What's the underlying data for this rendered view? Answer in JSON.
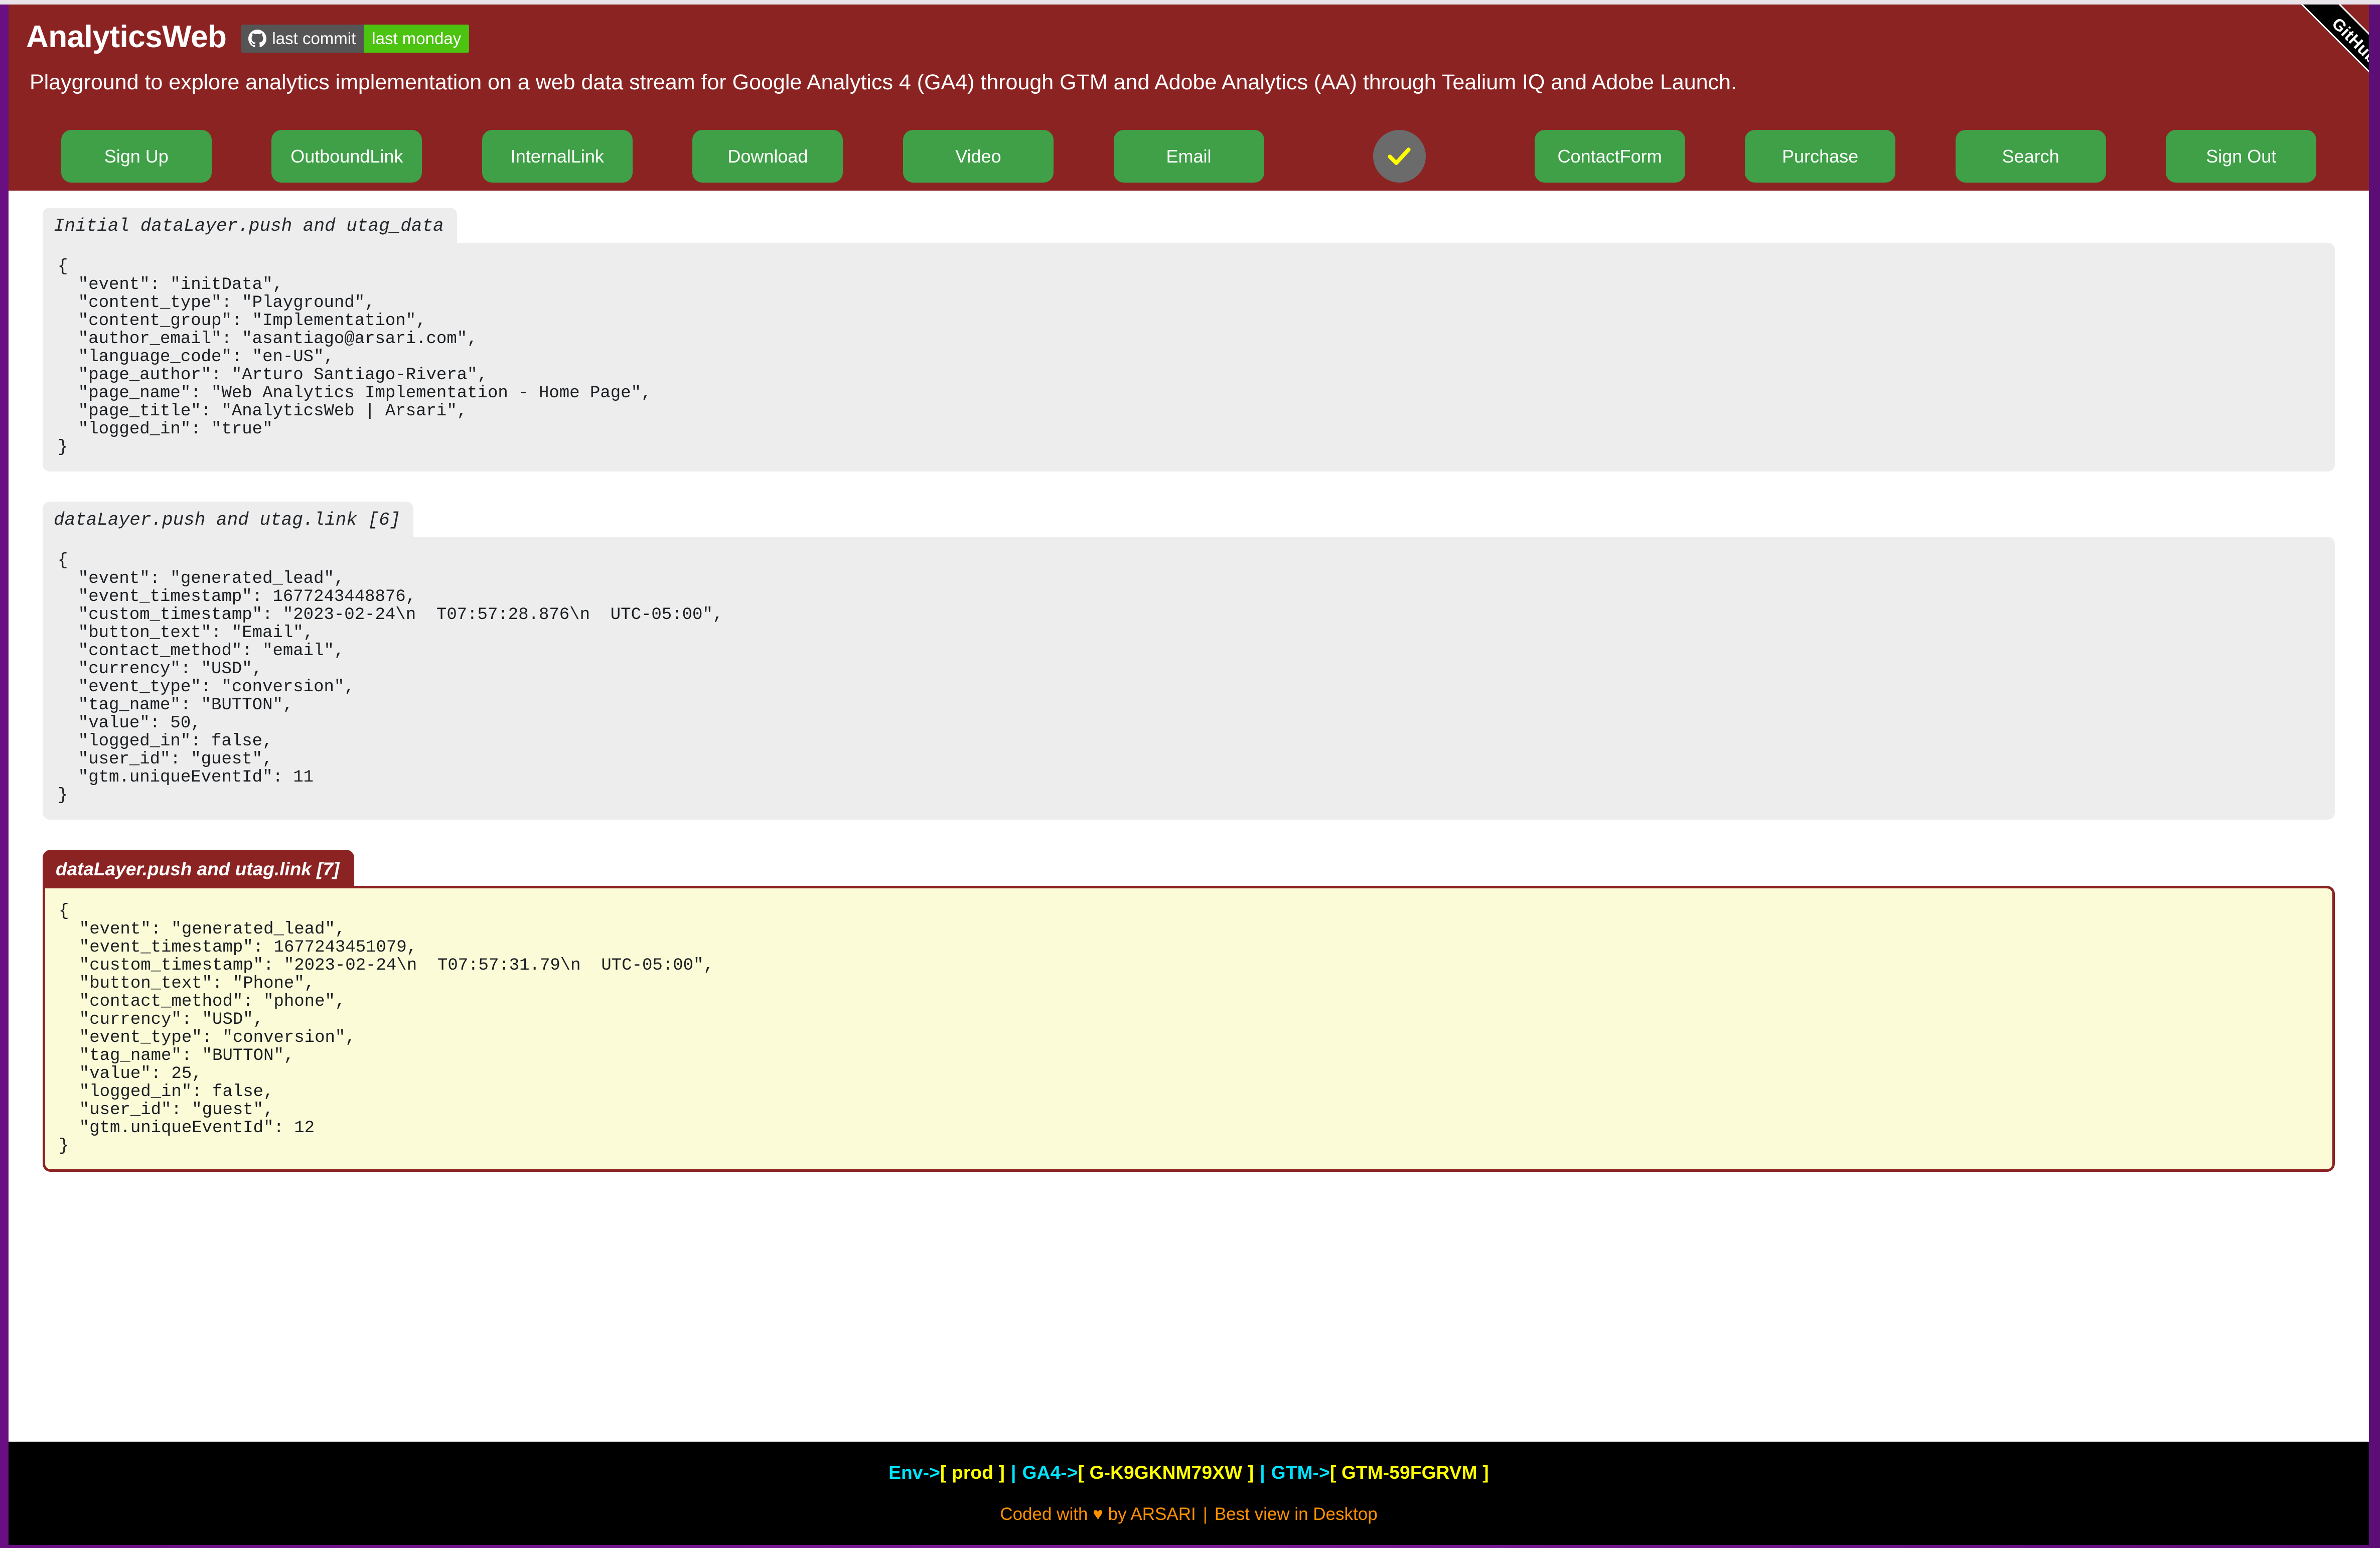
{
  "header": {
    "app_title": "AnalyticsWeb",
    "badge": {
      "icon": "github-octocat-icon",
      "label": "last commit",
      "value": "last monday",
      "label_color": "#555555",
      "value_color": "#4cc211"
    },
    "tagline": "Playground to explore analytics implementation on a web data stream for Google Analytics 4 (GA4) through GTM and Adobe Analytics (AA) through Tealium IQ and Adobe Launch.",
    "background_color": "#8c2323",
    "github_corner_label": "GitHub"
  },
  "nav_buttons": [
    {
      "label": "Sign Up",
      "type": "text",
      "name": "sign-up-button"
    },
    {
      "label": "Outbound\nLink",
      "type": "text",
      "name": "outbound-link-button"
    },
    {
      "label": "Internal\nLink",
      "type": "text",
      "name": "internal-link-button"
    },
    {
      "label": "Download",
      "type": "text",
      "name": "download-button"
    },
    {
      "label": "Video",
      "type": "text",
      "name": "video-button"
    },
    {
      "label": "Email",
      "type": "text",
      "name": "email-button"
    },
    {
      "label": "",
      "type": "check",
      "name": "phone-check-button"
    },
    {
      "label": "Contact\nForm",
      "type": "text",
      "name": "contact-form-button"
    },
    {
      "label": "Purchase",
      "type": "text",
      "name": "purchase-button"
    },
    {
      "label": "Search",
      "type": "text",
      "name": "search-button"
    },
    {
      "label": "Sign Out",
      "type": "text",
      "name": "sign-out-button"
    }
  ],
  "button_colors": {
    "green": "#3fa047",
    "check_circle": "#6b6b6b",
    "check_mark": "#ffff00"
  },
  "code_blocks": [
    {
      "tab_label": "Initial dataLayer.push and utag_data",
      "highlighted": false,
      "code": "{\n  \"event\": \"initData\",\n  \"content_type\": \"Playground\",\n  \"content_group\": \"Implementation\",\n  \"author_email\": \"asantiago@arsari.com\",\n  \"language_code\": \"en-US\",\n  \"page_author\": \"Arturo Santiago-Rivera\",\n  \"page_name\": \"Web Analytics Implementation - Home Page\",\n  \"page_title\": \"AnalyticsWeb | Arsari\",\n  \"logged_in\": \"true\"\n}"
    },
    {
      "tab_label": "dataLayer.push and utag.link [6]",
      "highlighted": false,
      "code": "{\n  \"event\": \"generated_lead\",\n  \"event_timestamp\": 1677243448876,\n  \"custom_timestamp\": \"2023-02-24\\n  T07:57:28.876\\n  UTC-05:00\",\n  \"button_text\": \"Email\",\n  \"contact_method\": \"email\",\n  \"currency\": \"USD\",\n  \"event_type\": \"conversion\",\n  \"tag_name\": \"BUTTON\",\n  \"value\": 50,\n  \"logged_in\": false,\n  \"user_id\": \"guest\",\n  \"gtm.uniqueEventId\": 11\n}"
    },
    {
      "tab_label": "dataLayer.push and utag.link [7]",
      "highlighted": true,
      "code": "{\n  \"event\": \"generated_lead\",\n  \"event_timestamp\": 1677243451079,\n  \"custom_timestamp\": \"2023-02-24\\n  T07:57:31.79\\n  UTC-05:00\",\n  \"button_text\": \"Phone\",\n  \"contact_method\": \"phone\",\n  \"currency\": \"USD\",\n  \"event_type\": \"conversion\",\n  \"tag_name\": \"BUTTON\",\n  \"value\": 25,\n  \"logged_in\": false,\n  \"user_id\": \"guest\",\n  \"gtm.uniqueEventId\": 12\n}"
    }
  ],
  "footer": {
    "env_label": "Env->",
    "env_value": "[ prod ]",
    "ga4_label": "GA4->",
    "ga4_value": "[ G-K9GKNM79XW ]",
    "gtm_label": "GTM->",
    "gtm_value": "[ GTM-59FGRVM ]",
    "separator": "|",
    "credit_prefix": "Coded with ",
    "heart": "♥",
    "credit_suffix": " by ARSARI",
    "credit_separator": "|",
    "credit_note": "Best view in Desktop",
    "label_color": "#00e5ff",
    "value_color": "#ffff00",
    "credit_color": "#ff9000",
    "background_color": "#000000"
  }
}
